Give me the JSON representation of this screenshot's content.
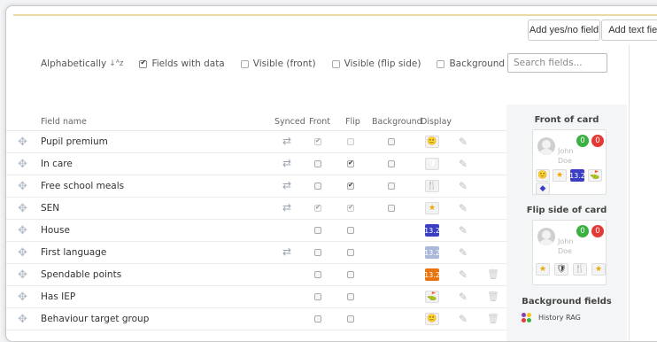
{
  "toolbar": {
    "add_yes_no": "Add yes/no field",
    "add_text": "Add text field"
  },
  "filters": {
    "alphabetically": "Alphabetically",
    "fields_with_data": "Fields with data",
    "visible_front": "Visible (front)",
    "visible_flip": "Visible (flip side)",
    "background_fields": "Background fields",
    "search_placeholder": "Search fields..."
  },
  "columns": {
    "field_name": "Field name",
    "synced": "Synced",
    "front": "Front",
    "flip": "Flip",
    "background": "Background",
    "display": "Display"
  },
  "rows": [
    {
      "name": "Pupil premium",
      "synced": true,
      "front": true,
      "flip": false,
      "background": false,
      "display": "smiley-icon"
    },
    {
      "name": "In care",
      "synced": true,
      "front": false,
      "flip": true,
      "background": false,
      "display": "shield-icon"
    },
    {
      "name": "Free school meals",
      "synced": true,
      "front": false,
      "flip": true,
      "background": false,
      "display": "fork-knife-icon"
    },
    {
      "name": "SEN",
      "synced": true,
      "front": true,
      "flip": true,
      "background": false,
      "display": "star-icon"
    },
    {
      "name": "House",
      "synced": false,
      "front": false,
      "flip": false,
      "background": false,
      "display": "13.2"
    },
    {
      "name": "First language",
      "synced": true,
      "front": false,
      "flip": false,
      "background": false,
      "display": "13.2"
    },
    {
      "name": "Spendable points",
      "synced": false,
      "front": false,
      "flip": false,
      "background": false,
      "display": "13.2"
    },
    {
      "name": "Has IEP",
      "synced": false,
      "front": false,
      "flip": false,
      "background": false,
      "display": "map-marker-icon"
    },
    {
      "name": "Behaviour target group",
      "synced": false,
      "front": false,
      "flip": false,
      "background": false,
      "display": "smiley-icon"
    }
  ],
  "panel": {
    "front_title": "Front of card",
    "flip_title": "Flip side of card",
    "background_title": "Background fields",
    "card_name_first": "John",
    "card_name_last": "Doe",
    "badge_green": "0",
    "badge_red": "0",
    "number": "13.2",
    "rag_label": "History RAG"
  },
  "colors": {
    "green": "#3bb143",
    "red": "#e53935",
    "navy": "#3b3ec1",
    "pale_blue": "#a9b8d8",
    "orange": "#e8740e",
    "rag_purple": "#8e3bb1",
    "rag_yellow": "#f5c518"
  }
}
